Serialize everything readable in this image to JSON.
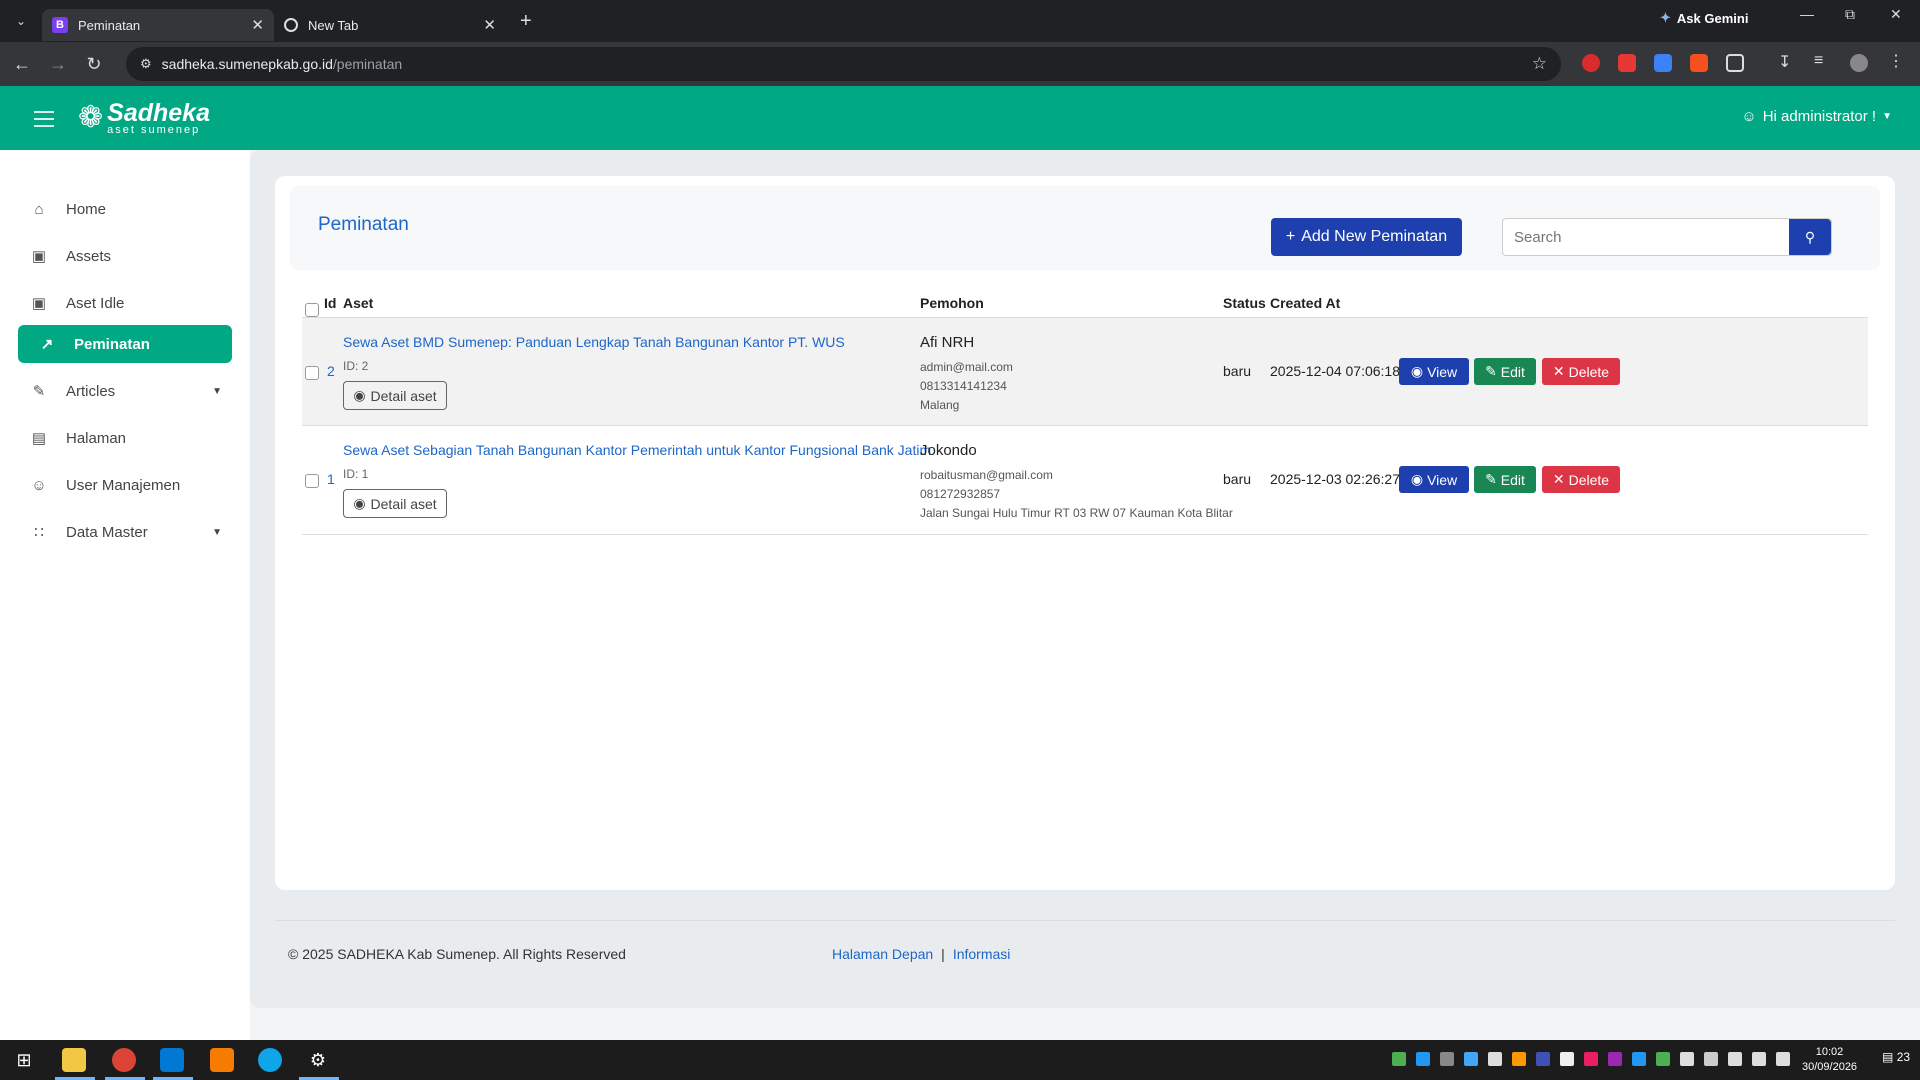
{
  "browser": {
    "tabs": [
      {
        "title": "Peminatan",
        "favicon": "B",
        "active": true
      },
      {
        "title": "New Tab",
        "active": false
      }
    ],
    "ask_gemini": "Ask Gemini",
    "url_host": "sadheka.sumenepkab.go.id",
    "url_path": "/peminatan"
  },
  "header": {
    "logo_name": "Sadheka",
    "logo_sub": "aset sumenep",
    "user_label": "Hi administrator !"
  },
  "sidebar": {
    "items": [
      {
        "label": "Home",
        "icon": "home-icon"
      },
      {
        "label": "Assets",
        "icon": "box-icon"
      },
      {
        "label": "Aset Idle",
        "icon": "box-icon"
      },
      {
        "label": "Peminatan",
        "icon": "chart-line-icon",
        "active": true
      },
      {
        "label": "Articles",
        "icon": "edit-icon",
        "has_caret": true
      },
      {
        "label": "Halaman",
        "icon": "page-icon"
      },
      {
        "label": "User Manajemen",
        "icon": "user-icon"
      },
      {
        "label": "Data Master",
        "icon": "grid-icon",
        "has_caret": true
      }
    ]
  },
  "page": {
    "title": "Peminatan",
    "add_button": "Add New Peminatan",
    "search_placeholder": "Search"
  },
  "table": {
    "headers": {
      "id": "Id",
      "aset": "Aset",
      "pemohon": "Pemohon",
      "status": "Status",
      "created_at": "Created At"
    },
    "rows": [
      {
        "id": "2",
        "aset_title": "Sewa Aset BMD Sumenep: Panduan Lengkap Tanah Bangunan Kantor PT. WUS",
        "aset_id": "ID: 2",
        "detail_label": "Detail aset",
        "pemohon_name": "Afi NRH",
        "pemohon_email": "admin@mail.com",
        "pemohon_phone": "0813314141234",
        "pemohon_address": "Malang",
        "status": "baru",
        "created_at": "2025-12-04 07:06:18"
      },
      {
        "id": "1",
        "aset_title": "Sewa Aset Sebagian Tanah Bangunan Kantor Pemerintah untuk Kantor Fungsional Bank Jatim",
        "aset_id": "ID: 1",
        "detail_label": "Detail aset",
        "pemohon_name": "Jokondo",
        "pemohon_email": "robaitusman@gmail.com",
        "pemohon_phone": "081272932857",
        "pemohon_address": "Jalan Sungai Hulu Timur RT 03 RW 07 Kauman Kota Blitar",
        "status": "baru",
        "created_at": "2025-12-03 02:26:27"
      }
    ],
    "actions": {
      "view": "View",
      "edit": "Edit",
      "delete": "Delete"
    }
  },
  "footer": {
    "copyright": "© 2025 SADHEKA Kab Sumenep. All Rights Reserved",
    "link1": "Halaman Depan",
    "separator": "|",
    "link2": "Informasi"
  },
  "taskbar": {
    "time": "10:02",
    "date": "30/09/2026",
    "notification_count": "23"
  },
  "colors": {
    "brand_green": "#00a884",
    "primary_blue": "#1e40af",
    "link_blue": "#1e66c8",
    "success": "#198754",
    "danger": "#dc3545"
  }
}
